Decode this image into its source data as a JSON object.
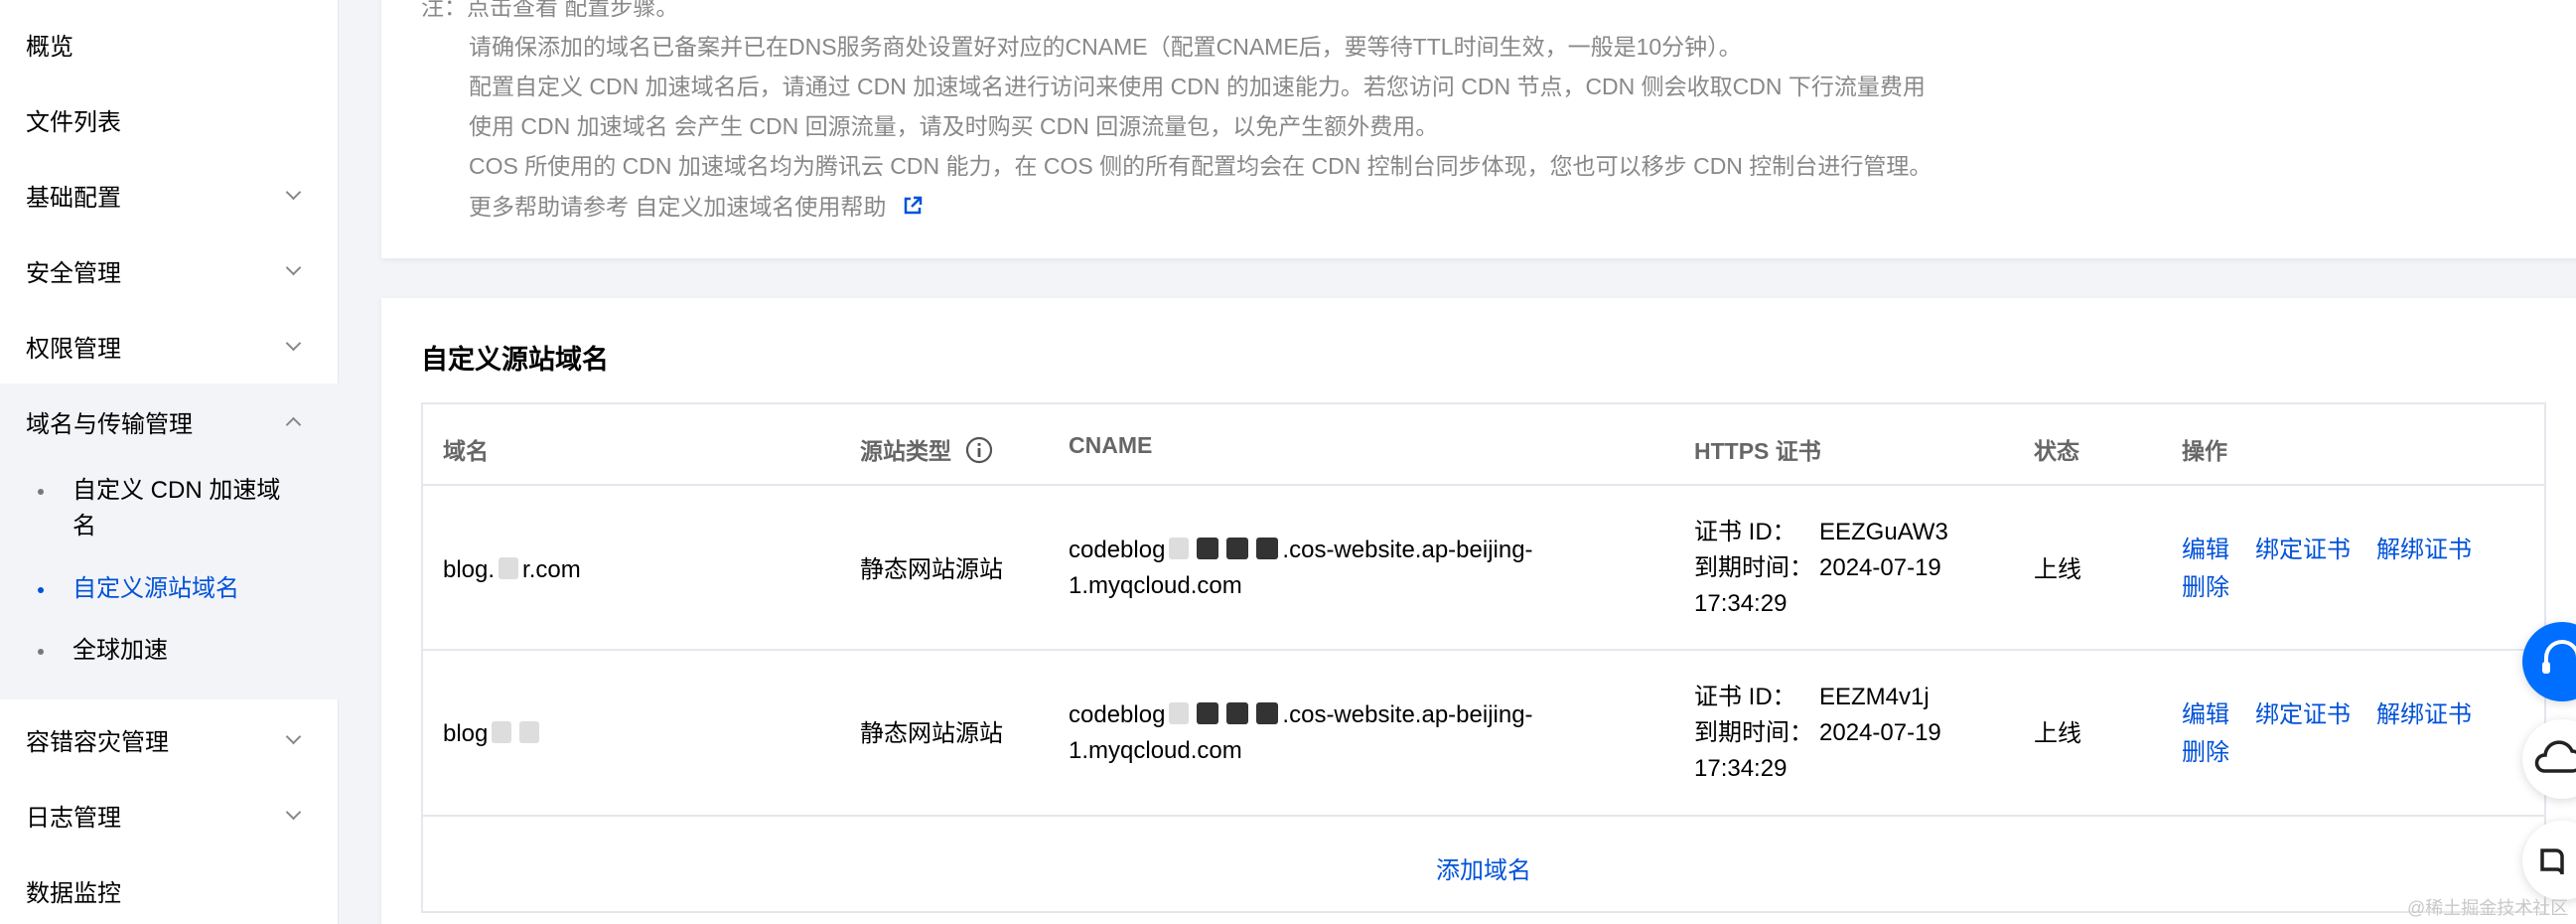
{
  "sidebar": {
    "items": [
      {
        "label": "概览"
      },
      {
        "label": "文件列表"
      },
      {
        "label": "基础配置"
      },
      {
        "label": "安全管理"
      },
      {
        "label": "权限管理"
      },
      {
        "label": "域名与传输管理"
      },
      {
        "label": "容错容灾管理"
      },
      {
        "label": "日志管理"
      },
      {
        "label": "数据监控"
      }
    ],
    "sub_items": [
      {
        "label": "自定义 CDN 加速域名"
      },
      {
        "label": "自定义源站域名"
      },
      {
        "label": "全球加速"
      }
    ]
  },
  "notice": {
    "line0_prefix": "注：点击查看",
    "line0_link": "配置步骤",
    "line0_suffix": "。",
    "line1": "请确保添加的域名已备案并已在DNS服务商处设置好对应的CNAME（配置CNAME后，要等待TTL时间生效，一般是10分钟）。",
    "line2": "配置自定义 CDN 加速域名后，请通过 CDN 加速域名进行访问来使用 CDN 的加速能力。若您访问 CDN 节点，CDN 侧会收取",
    "line2_link": "CDN 下行流量费用",
    "line3_prefix": "使用 CDN 加速域名 会产生 CDN 回源流量，请及时购买",
    "line3_link": "CDN 回源流量包",
    "line3_suffix": "，以免产生额外费用。",
    "line4_prefix": "COS 所使用的 CDN 加速域名均为腾讯云 CDN 能力，在 COS 侧的所有配置均会在 CDN 控制台同步体现，您也可以移步",
    "line4_link": "CDN 控制台",
    "line4_suffix": "进行管理。",
    "line5_prefix": "更多帮助请参考",
    "line5_link": "自定义加速域名使用帮助"
  },
  "section": {
    "title": "自定义源站域名"
  },
  "table": {
    "headers": [
      "域名",
      "源站类型",
      "CNAME",
      "HTTPS 证书",
      "状态",
      "操作"
    ],
    "rows": [
      {
        "domain_a": "blog.",
        "domain_b": "r.com",
        "origin_type": "静态网站源站",
        "cname_a": "codeblog",
        "cname_b": ".cos-website.ap-beijing-",
        "cname_c": "1.myqcloud.com",
        "cert_id_label": "证书 ID：",
        "cert_id": "EEZGuAW3",
        "expire_label": "到期时间：",
        "expire_date": "2024-07-19",
        "expire_time": "17:34:29",
        "status": "上线",
        "ops": [
          "编辑",
          "绑定证书",
          "解绑证书",
          "删除"
        ]
      },
      {
        "domain_a": "blog",
        "domain_b": "",
        "origin_type": "静态网站源站",
        "cname_a": "codeblog",
        "cname_b": ".cos-website.ap-beijing-",
        "cname_c": "1.myqcloud.com",
        "cert_id_label": "证书 ID：",
        "cert_id": "EEZM4v1j",
        "expire_label": "到期时间：",
        "expire_date": "2024-07-19",
        "expire_time": "17:34:29",
        "status": "上线",
        "ops": [
          "编辑",
          "绑定证书",
          "解绑证书",
          "删除"
        ]
      }
    ],
    "add_label": "添加域名"
  },
  "watermark": "@稀土掘金技术社区",
  "colors": {
    "accent": "#0052d9",
    "muted": "#888888",
    "border": "#e5e7ee"
  }
}
